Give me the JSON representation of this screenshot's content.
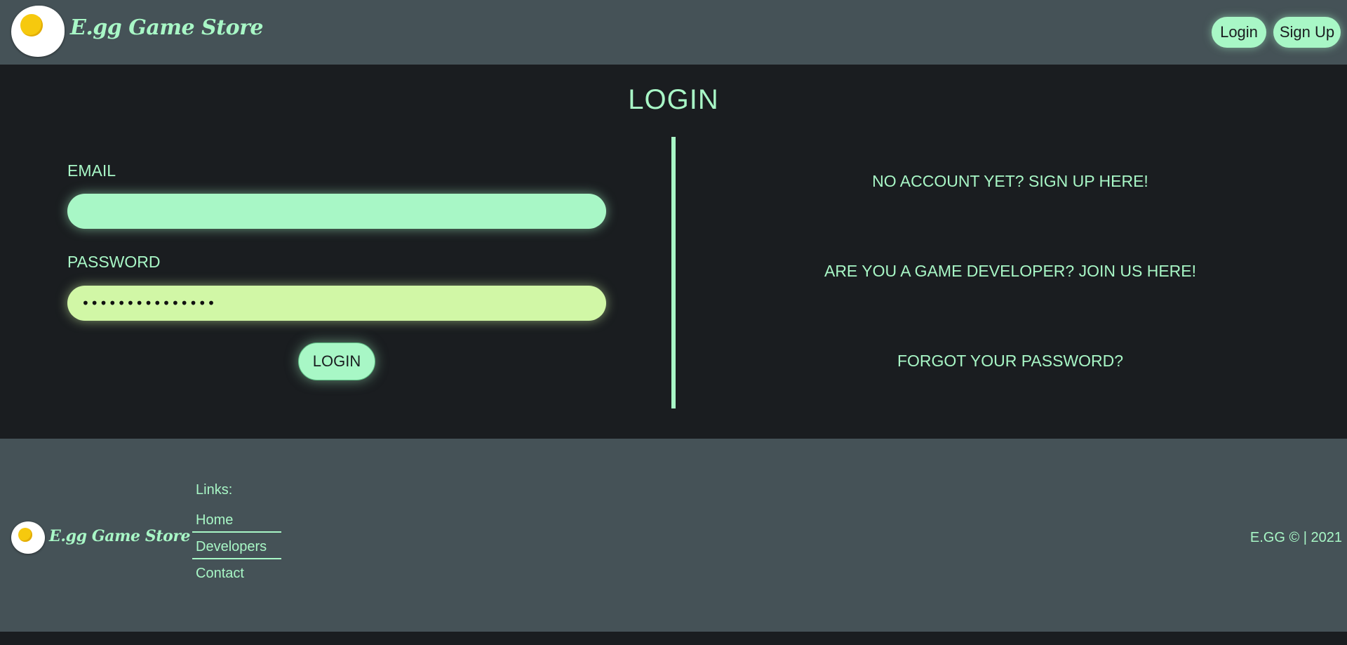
{
  "header": {
    "brand": "E.gg Game Store",
    "login_label": "Login",
    "signup_label": "Sign Up"
  },
  "main": {
    "title": "LOGIN",
    "email_label": "EMAIL",
    "email_value": "",
    "password_label": "PASSWORD",
    "password_value": "•••••••••••••••",
    "login_button": "LOGIN",
    "links": {
      "signup": "NO ACCOUNT YET? SIGN UP HERE!",
      "developer": "ARE YOU A GAME DEVELOPER? JOIN US HERE!",
      "forgot": "FORGOT YOUR PASSWORD?"
    }
  },
  "footer": {
    "brand": "E.gg Game Store",
    "links_title": "Links:",
    "links": [
      "Home",
      "Developers",
      "Contact"
    ],
    "copyright": "E.GG © | 2021"
  },
  "colors": {
    "accent": "#a8f7c6",
    "password_field": "#d1f7a6",
    "header_bg": "#455257",
    "page_bg": "#1a1d20",
    "yolk": "#f6c90e"
  },
  "icons": {
    "logo": "fried-egg-icon"
  }
}
